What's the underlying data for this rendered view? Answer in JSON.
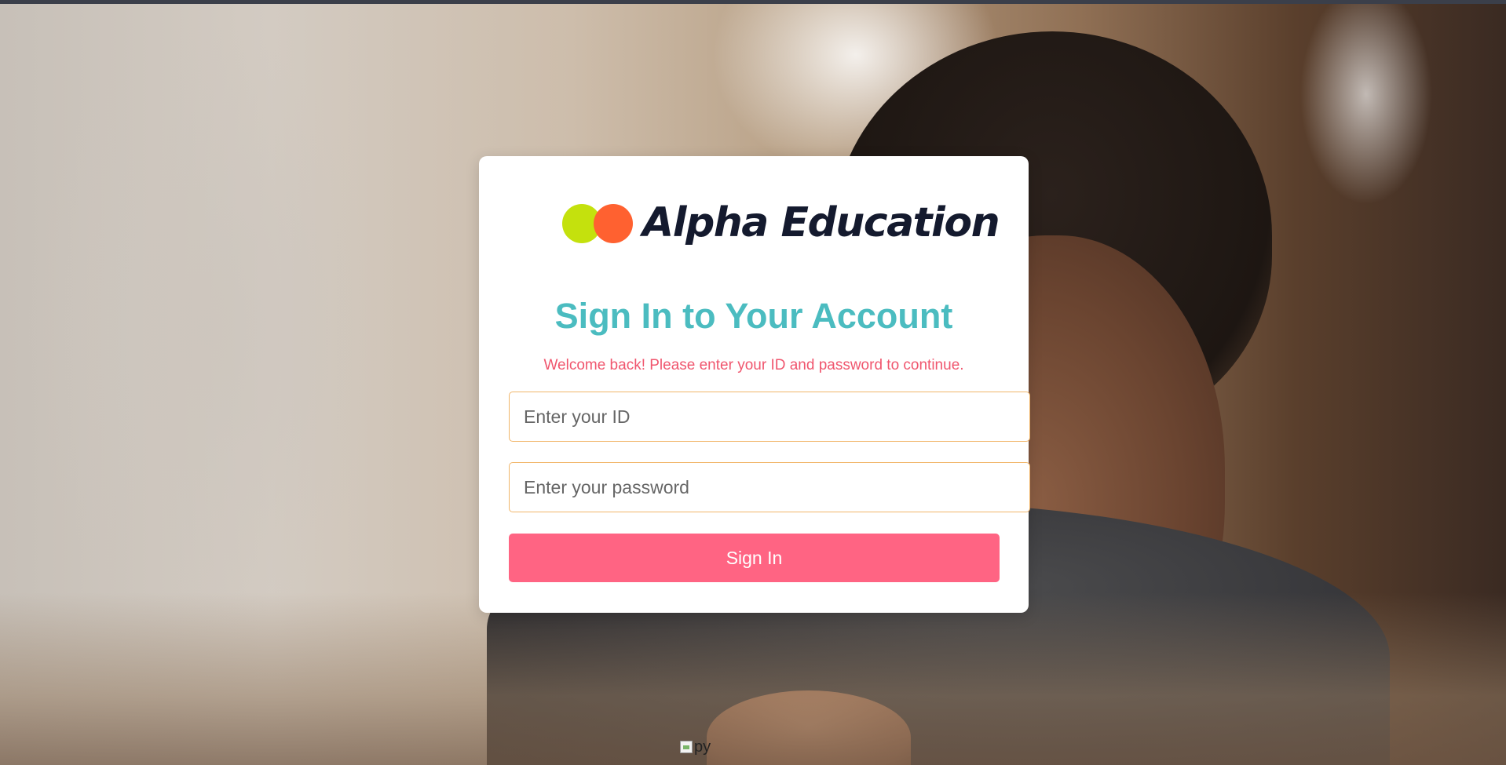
{
  "brand": {
    "name": "Alpha Education",
    "logo_colors": [
      "#c4e10d",
      "#ff6130"
    ]
  },
  "login": {
    "title": "Sign In to Your Account",
    "subtitle": "Welcome back! Please enter your ID and password to continue.",
    "id_placeholder": "Enter your ID",
    "id_value": "",
    "password_placeholder": "Enter your password",
    "password_value": "",
    "signin_label": "Sign In"
  },
  "footer_image": {
    "alt": "py"
  },
  "colors": {
    "title": "#4bbcc0",
    "subtitle": "#f0566e",
    "input_border": "#f1b66a",
    "button_bg": "#ff6483",
    "button_text": "#ffffff",
    "card_bg": "#ffffff"
  }
}
